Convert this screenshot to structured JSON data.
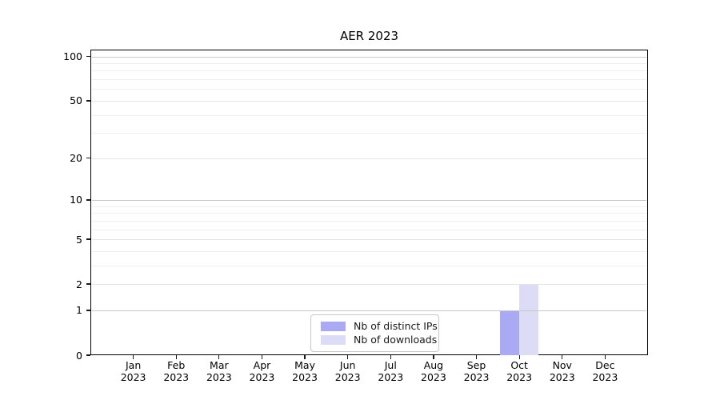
{
  "chart": {
    "title": "AER 2023"
  },
  "chart_data": {
    "type": "bar",
    "title": "AER 2023",
    "categories": [
      "Jan 2023",
      "Feb 2023",
      "Mar 2023",
      "Apr 2023",
      "May 2023",
      "Jun 2023",
      "Jul 2023",
      "Aug 2023",
      "Sep 2023",
      "Oct 2023",
      "Nov 2023",
      "Dec 2023"
    ],
    "series": [
      {
        "name": "Nb of distinct IPs",
        "color": "#a9a9f4",
        "values": [
          0,
          0,
          0,
          0,
          0,
          0,
          0,
          0,
          0,
          1,
          0,
          0
        ]
      },
      {
        "name": "Nb of downloads",
        "color": "#dcdcf7",
        "values": [
          0,
          0,
          0,
          0,
          0,
          0,
          0,
          0,
          0,
          2,
          0,
          0
        ]
      }
    ],
    "yscale": "log10(1+x)",
    "ylim": [
      0,
      112
    ],
    "yticks": [
      0,
      1,
      2,
      5,
      10,
      20,
      50,
      100
    ],
    "major_gridlines": [
      1,
      10,
      100
    ],
    "minor_gridlines": [
      3,
      4,
      6,
      7,
      8,
      9,
      30,
      40,
      60,
      70,
      80,
      90
    ],
    "grid": true,
    "legend_position": "bottom-center"
  }
}
